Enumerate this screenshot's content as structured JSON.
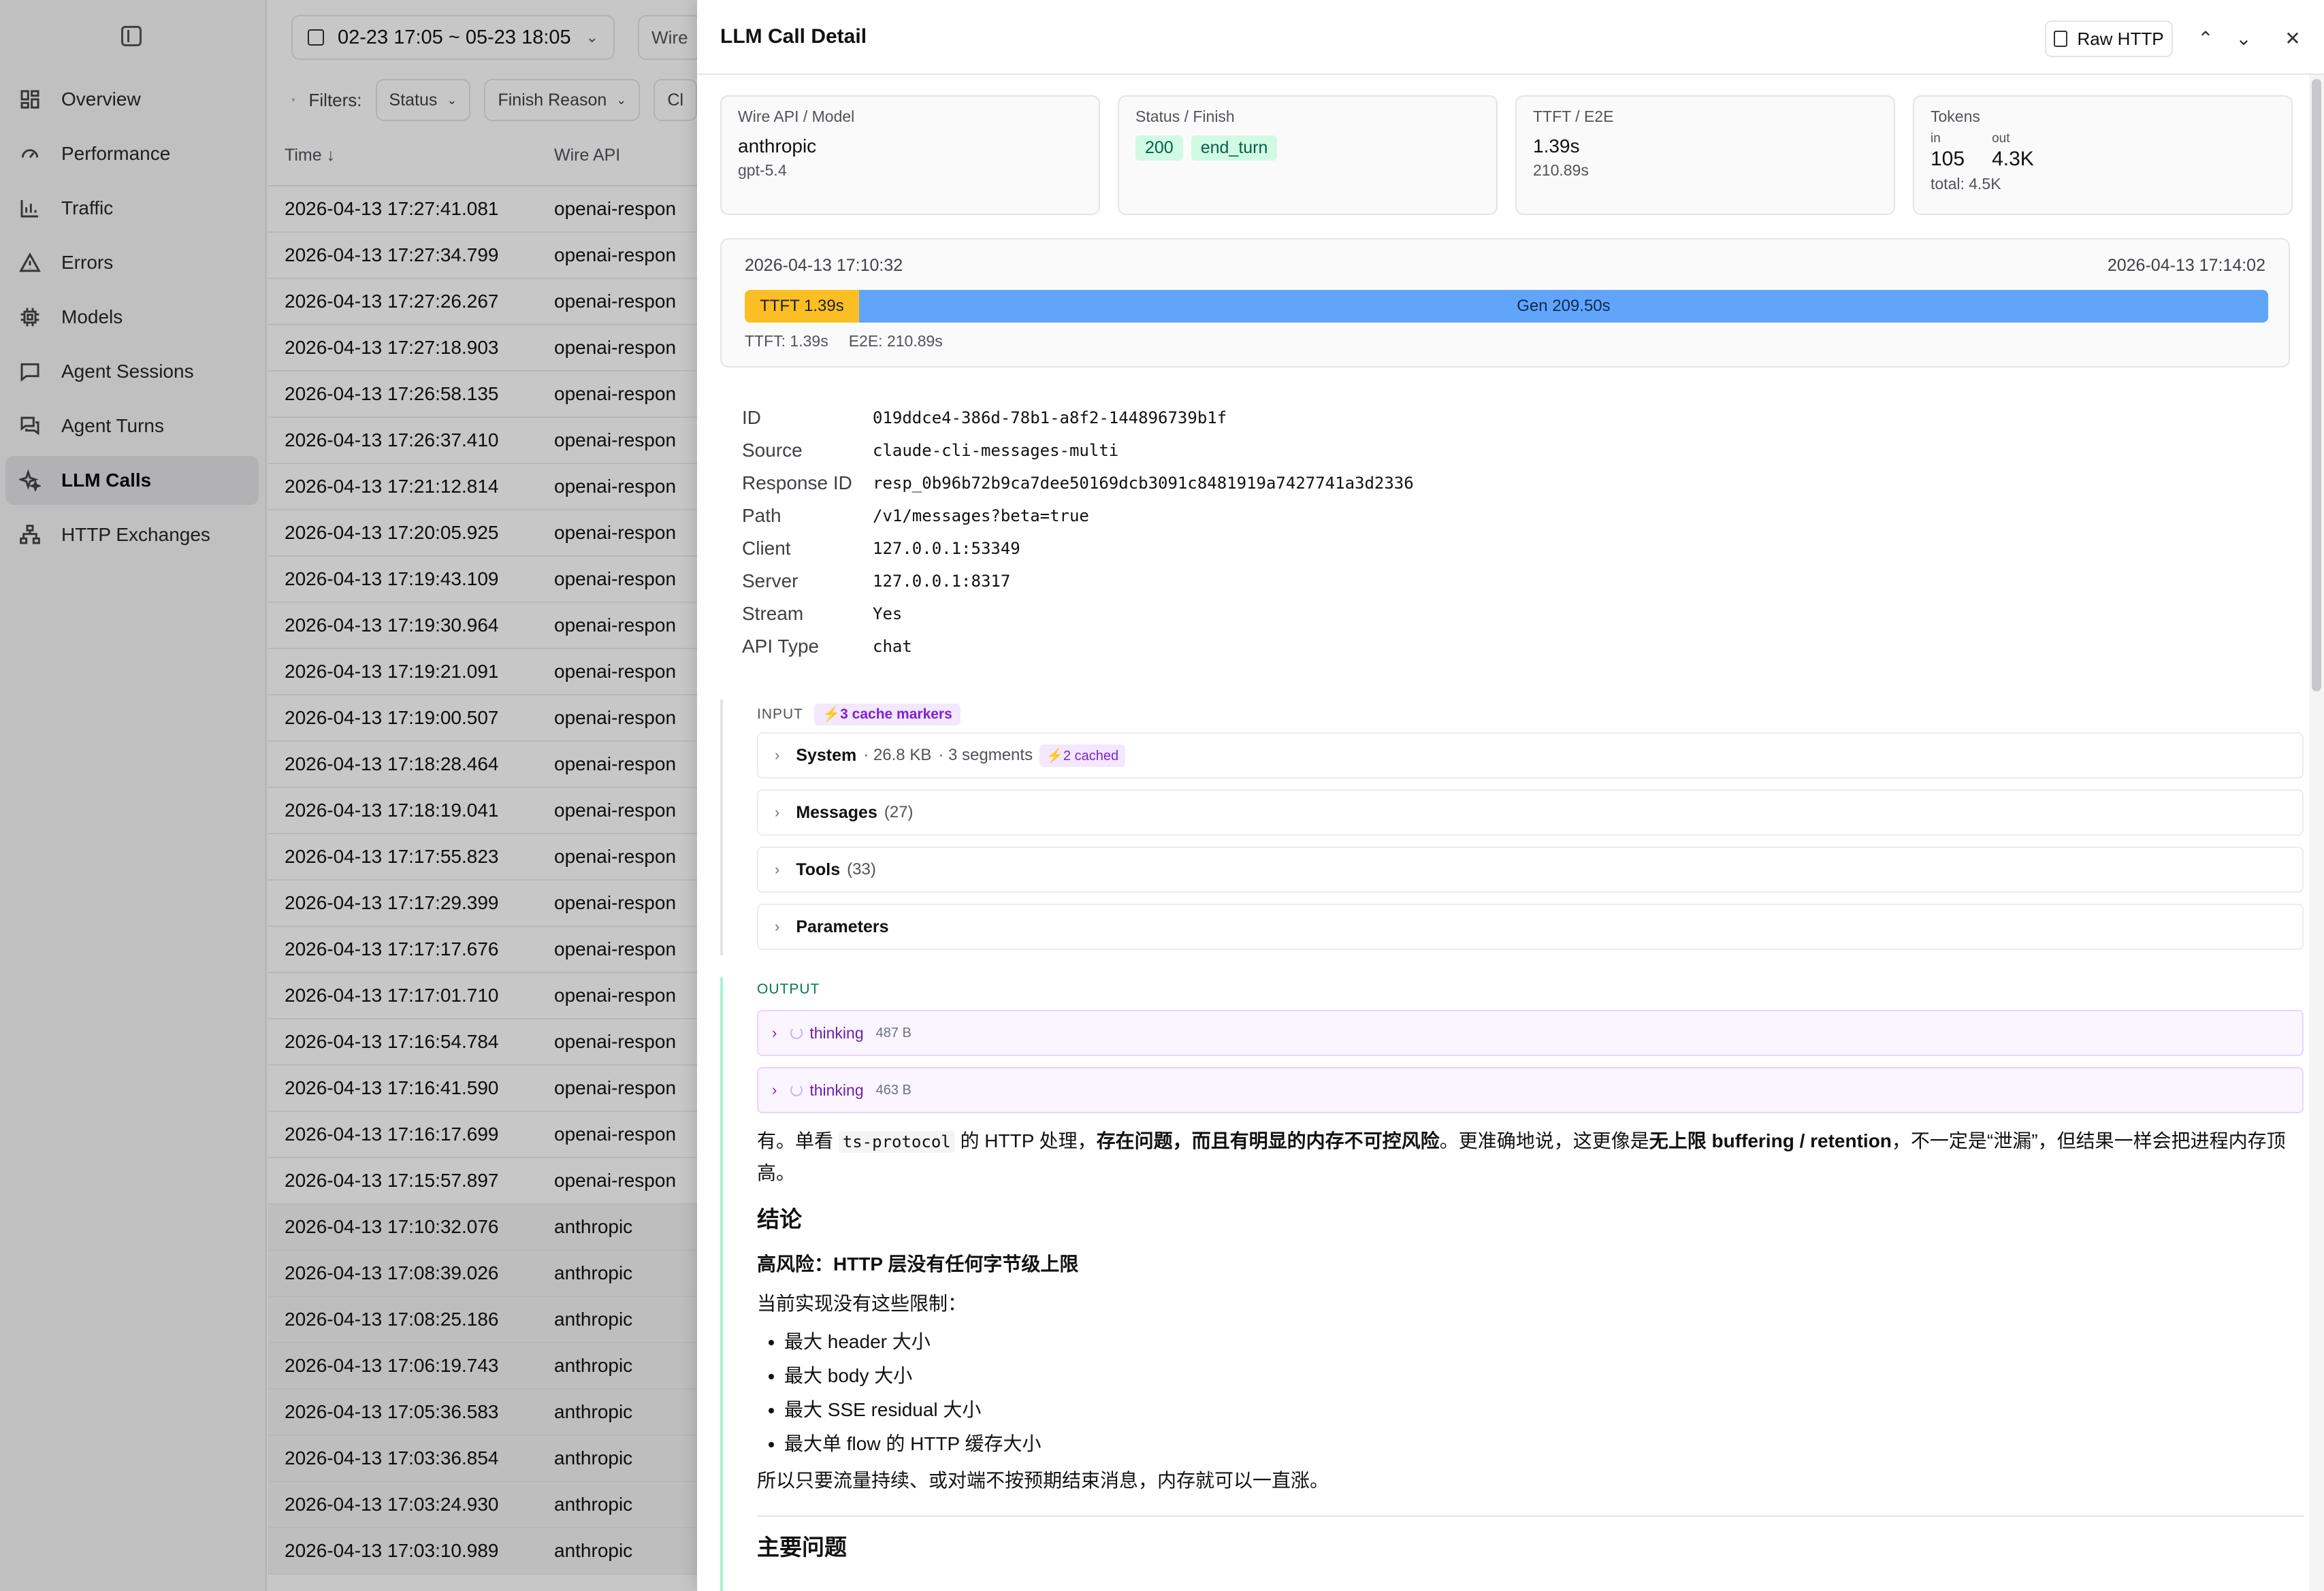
{
  "sidebar": {
    "items": [
      {
        "label": "Overview",
        "icon": "grid-icon"
      },
      {
        "label": "Performance",
        "icon": "gauge-icon"
      },
      {
        "label": "Traffic",
        "icon": "bar-chart-icon"
      },
      {
        "label": "Errors",
        "icon": "warning-icon"
      },
      {
        "label": "Models",
        "icon": "chip-icon"
      },
      {
        "label": "Agent Sessions",
        "icon": "chat-icon"
      },
      {
        "label": "Agent Turns",
        "icon": "chats-icon"
      },
      {
        "label": "LLM Calls",
        "icon": "sparkles-icon",
        "active": true
      },
      {
        "label": "HTTP Exchanges",
        "icon": "network-icon"
      }
    ]
  },
  "list": {
    "date_range": "02-23 17:05 ~ 05-23 18:05",
    "wire_pill": "Wire",
    "filters_label": "Filters:",
    "filter_status": "Status",
    "filter_finish": "Finish Reason",
    "filter_more": "Cl",
    "col_time": "Time ↓",
    "col_wire": "Wire API",
    "rows": [
      {
        "time": "2026-04-13 17:27:41.081",
        "wire": "openai-respon"
      },
      {
        "time": "2026-04-13 17:27:34.799",
        "wire": "openai-respon"
      },
      {
        "time": "2026-04-13 17:27:26.267",
        "wire": "openai-respon"
      },
      {
        "time": "2026-04-13 17:27:18.903",
        "wire": "openai-respon"
      },
      {
        "time": "2026-04-13 17:26:58.135",
        "wire": "openai-respon"
      },
      {
        "time": "2026-04-13 17:26:37.410",
        "wire": "openai-respon"
      },
      {
        "time": "2026-04-13 17:21:12.814",
        "wire": "openai-respon"
      },
      {
        "time": "2026-04-13 17:20:05.925",
        "wire": "openai-respon"
      },
      {
        "time": "2026-04-13 17:19:43.109",
        "wire": "openai-respon"
      },
      {
        "time": "2026-04-13 17:19:30.964",
        "wire": "openai-respon"
      },
      {
        "time": "2026-04-13 17:19:21.091",
        "wire": "openai-respon"
      },
      {
        "time": "2026-04-13 17:19:00.507",
        "wire": "openai-respon"
      },
      {
        "time": "2026-04-13 17:18:28.464",
        "wire": "openai-respon"
      },
      {
        "time": "2026-04-13 17:18:19.041",
        "wire": "openai-respon"
      },
      {
        "time": "2026-04-13 17:17:55.823",
        "wire": "openai-respon"
      },
      {
        "time": "2026-04-13 17:17:29.399",
        "wire": "openai-respon"
      },
      {
        "time": "2026-04-13 17:17:17.676",
        "wire": "openai-respon"
      },
      {
        "time": "2026-04-13 17:17:01.710",
        "wire": "openai-respon"
      },
      {
        "time": "2026-04-13 17:16:54.784",
        "wire": "openai-respon"
      },
      {
        "time": "2026-04-13 17:16:41.590",
        "wire": "openai-respon"
      },
      {
        "time": "2026-04-13 17:16:17.699",
        "wire": "openai-respon"
      },
      {
        "time": "2026-04-13 17:15:57.897",
        "wire": "openai-respon"
      },
      {
        "time": "2026-04-13 17:10:32.076",
        "wire": "anthropic"
      },
      {
        "time": "2026-04-13 17:08:39.026",
        "wire": "anthropic"
      },
      {
        "time": "2026-04-13 17:08:25.186",
        "wire": "anthropic"
      },
      {
        "time": "2026-04-13 17:06:19.743",
        "wire": "anthropic"
      },
      {
        "time": "2026-04-13 17:05:36.583",
        "wire": "anthropic"
      },
      {
        "time": "2026-04-13 17:03:36.854",
        "wire": "anthropic"
      },
      {
        "time": "2026-04-13 17:03:24.930",
        "wire": "anthropic"
      },
      {
        "time": "2026-04-13 17:03:10.989",
        "wire": "anthropic"
      }
    ]
  },
  "detail": {
    "title": "LLM Call Detail",
    "raw_http": "Raw HTTP",
    "cards": {
      "wire": {
        "label": "Wire API / Model",
        "main": "anthropic",
        "sub": "gpt-5.4"
      },
      "status": {
        "label": "Status / Finish",
        "code": "200",
        "finish": "end_turn"
      },
      "ttft": {
        "label": "TTFT / E2E",
        "main": "1.39s",
        "sub": "210.89s"
      },
      "tokens": {
        "label": "Tokens",
        "in_label": "in",
        "in": "105",
        "out_label": "out",
        "out": "4.3K",
        "total": "total: 4.5K"
      }
    },
    "timeline": {
      "start": "2026-04-13 17:10:32",
      "end": "2026-04-13 17:14:02",
      "ttft_label": "TTFT 1.39s",
      "gen_label": "Gen 209.50s",
      "ttft_fraction": 0.075,
      "foot_ttft": "TTFT: 1.39s",
      "foot_e2e": "E2E: 210.89s"
    },
    "kv": [
      {
        "k": "ID",
        "v": "019ddce4-386d-78b1-a8f2-144896739b1f"
      },
      {
        "k": "Source",
        "v": "claude-cli-messages-multi"
      },
      {
        "k": "Response ID",
        "v": "resp_0b96b72b9ca7dee50169dcb3091c8481919a7427741a3d2336"
      },
      {
        "k": "Path",
        "v": "/v1/messages?beta=true"
      },
      {
        "k": "Client",
        "v": "127.0.0.1:53349"
      },
      {
        "k": "Server",
        "v": "127.0.0.1:8317"
      },
      {
        "k": "Stream",
        "v": "Yes"
      },
      {
        "k": "API Type",
        "v": "chat"
      }
    ],
    "input": {
      "label": "INPUT",
      "cache_markers": "⚡3 cache markers",
      "system": {
        "title": "System",
        "size": "· 26.8 KB",
        "segments": "· 3 segments",
        "cached": "⚡2 cached"
      },
      "messages": {
        "title": "Messages",
        "count": "(27)"
      },
      "tools": {
        "title": "Tools",
        "count": "(33)"
      },
      "parameters": {
        "title": "Parameters"
      }
    },
    "output": {
      "label": "OUTPUT",
      "thinking": [
        {
          "label": "thinking",
          "size": "487 B"
        },
        {
          "label": "thinking",
          "size": "463 B"
        }
      ],
      "p1_a": "有。单看 ",
      "p1_code": "ts-protocol",
      "p1_b": " 的 HTTP 处理，",
      "p1_bold1": "存在问题，而且有明显的内存不可控风险",
      "p1_c": "。更准确地说，这更像是",
      "p1_bold2": "无上限 buffering / retention",
      "p1_d": "，不一定是“泄漏”，但结果一样会把进程内存顶高。",
      "h_conclusion": "结论",
      "h_risk": "高风险：HTTP 层没有任何字节级上限",
      "p_limits": "当前实现没有这些限制：",
      "bullets": [
        "最大 header 大小",
        "最大 body 大小",
        "最大 SSE residual 大小",
        "最大单 flow 的 HTTP 缓存大小"
      ],
      "p_growth": "所以只要流量持续、或对端不按预期结束消息，内存就可以一直涨。",
      "h_issues": "主要问题"
    }
  }
}
